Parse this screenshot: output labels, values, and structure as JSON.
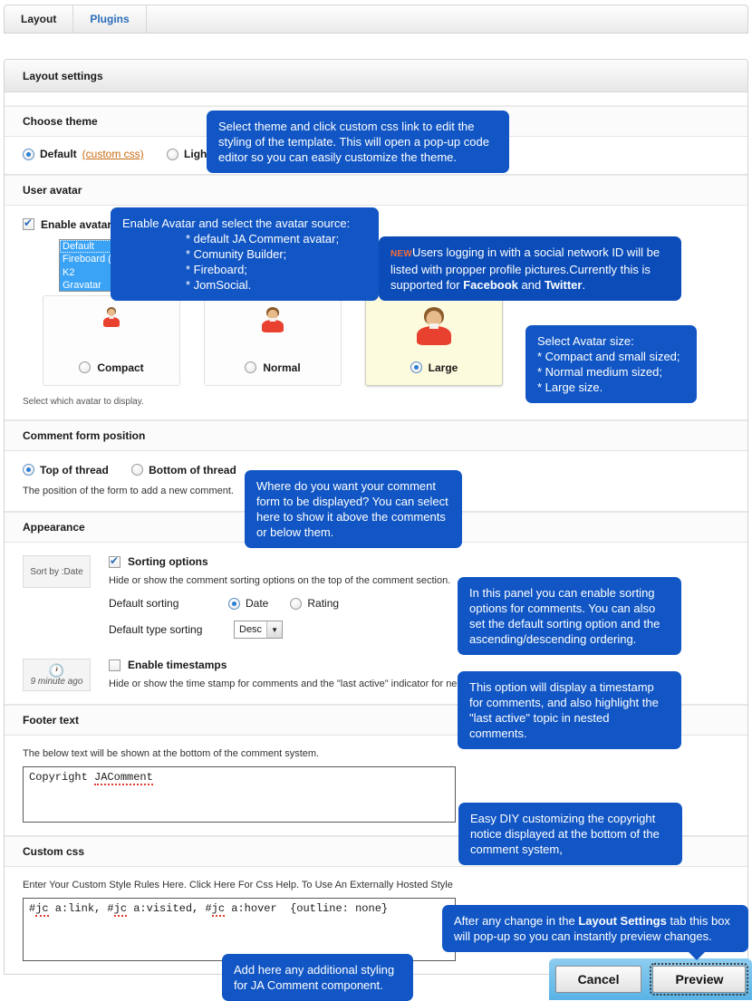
{
  "tabs": [
    {
      "label": "Layout",
      "active": true
    },
    {
      "label": "Plugins",
      "active": false
    }
  ],
  "panel": {
    "title": "Layout settings"
  },
  "sections": {
    "theme": {
      "heading": "Choose theme",
      "default_label": "Default",
      "custom_css_link": "(custom css)",
      "light_label": "Light"
    },
    "avatar": {
      "heading": "User avatar",
      "enable_label": "Enable avatar",
      "sources": [
        "Default",
        "Fireboard (Kunena)",
        "K2",
        "Gravatar"
      ],
      "cards": [
        {
          "label": "Compact",
          "selected": false
        },
        {
          "label": "Normal",
          "selected": false
        },
        {
          "label": "Large",
          "selected": true
        }
      ],
      "footnote": "Select which avatar to display."
    },
    "form_position": {
      "heading": "Comment form position",
      "top_label": "Top of thread",
      "bottom_label": "Bottom of thread",
      "footnote": "The position of the form to add a new comment."
    },
    "appearance": {
      "heading": "Appearance",
      "sort_thumb": "Sort by :Date",
      "sorting_label": "Sorting options",
      "sorting_hint": "Hide or show the comment sorting options on the top of the comment section.",
      "default_sorting_label": "Default sorting",
      "sort_date": "Date",
      "sort_rating": "Rating",
      "default_type_label": "Default type sorting",
      "default_type_value": "Desc",
      "timestamp_thumb": "9 minute ago",
      "timestamp_label": "Enable timestamps",
      "timestamp_hint": "Hide or show the time stamp for comments and the \"last active\" indicator for nest"
    },
    "footer_text": {
      "heading": "Footer text",
      "hint": "The below text will be shown at the bottom of the comment system.",
      "value_prefix": "Copyright ",
      "value_word": "JAComment"
    },
    "custom_css": {
      "heading": "Custom css",
      "hint": "Enter Your Custom Style Rules Here. Click Here For Css Help. To Use An Externally Hosted Style",
      "code_a": "#",
      "code_jc": "jc",
      "code_b": " a:link, ",
      "code_c": " a:visited, ",
      "code_d": " a:hover  {outline: none}"
    }
  },
  "tooltips": {
    "theme": "Select theme and click custom css link to edit the styling of the template. This will open a pop-up code editor so you can easily customize the theme.",
    "avatar_source": {
      "line1": "Enable Avatar and select the avatar source:",
      "line2": "* default JA Comment avatar;",
      "line3": "* Comunity Builder;",
      "line4": "* Fireboard;",
      "line5": "* JomSocial."
    },
    "social": {
      "badge": "NEW",
      "t1": "Users logging in with a social network ID will be listed with propper profile pictures.Currently this is supported for ",
      "b1": "Facebook",
      "t2": " and ",
      "b2": "Twitter",
      "t3": "."
    },
    "avatar_size": {
      "line1": "Select Avatar size:",
      "line2": "* Compact and small sized;",
      "line3": "* Normal medium sized;",
      "line4": "* Large size."
    },
    "form_position": "Where do you want your comment form to be displayed? You can select here to show it above the comments or below them.",
    "sorting": "In this panel you can enable sorting options for comments. You can also set the default sorting option and the ascending/descending ordering.",
    "timestamps": "This option will display a timestamp for comments, and also highlight the \"last active\" topic in nested comments.",
    "footer": "Easy DIY customizing the copyright notice displayed at the bottom of the comment system,",
    "custom_css": "Add here any additional styling for JA Comment component.",
    "preview": {
      "t1": "After any change in the ",
      "b1": "Layout Settings",
      "t2": " tab this box will pop-up so you can instantly preview changes."
    }
  },
  "preview_bar": {
    "cancel_label": "Cancel",
    "preview_label": "Preview"
  },
  "colors": {
    "tooltip_blue": "#1156c4",
    "link_orange": "#c96a10",
    "tab_link_blue": "#2a6ebb",
    "new_badge": "#f26a3a",
    "selected_card": "#fdfbdd"
  }
}
